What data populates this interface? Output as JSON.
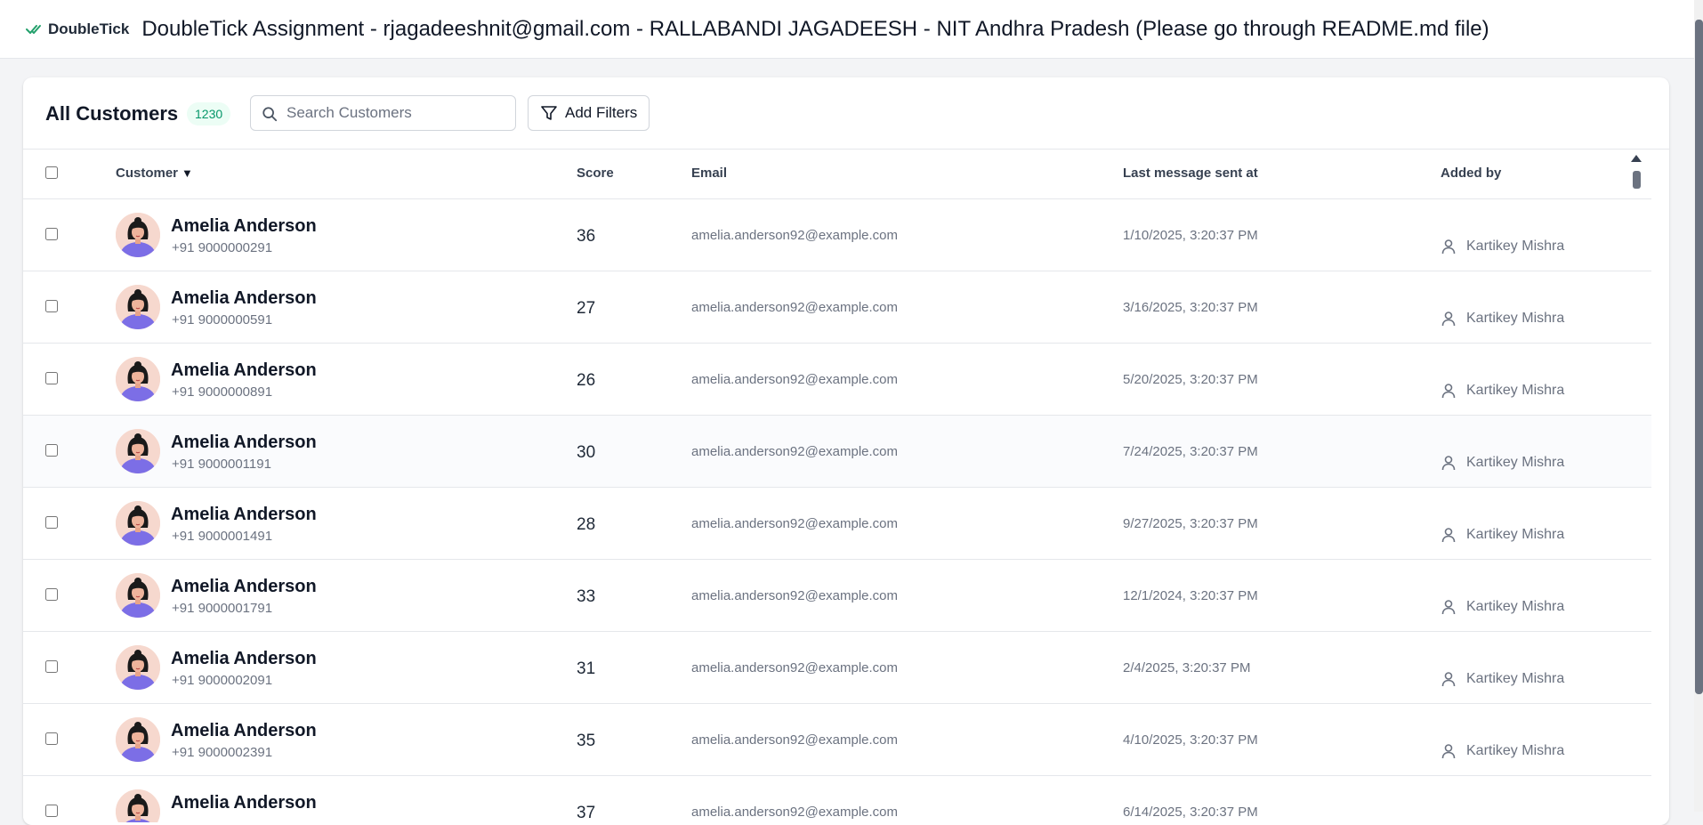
{
  "header": {
    "brand": "DoubleTick",
    "title": "DoubleTick Assignment - rjagadeeshnit@gmail.com - RALLABANDI JAGADEESH - NIT Andhra Pradesh (Please go through README.md file)"
  },
  "toolbar": {
    "title": "All Customers",
    "count": "1230",
    "search_placeholder": "Search Customers",
    "search_value": "",
    "filter_label": "Add Filters"
  },
  "columns": {
    "customer": "Customer",
    "score": "Score",
    "email": "Email",
    "last_message": "Last message sent at",
    "added_by": "Added by"
  },
  "rows": [
    {
      "name": "Amelia Anderson",
      "phone": "+91 9000000291",
      "score": "36",
      "email": "amelia.anderson92@example.com",
      "last_message": "1/10/2025, 3:20:37 PM",
      "added_by": "Kartikey Mishra"
    },
    {
      "name": "Amelia Anderson",
      "phone": "+91 9000000591",
      "score": "27",
      "email": "amelia.anderson92@example.com",
      "last_message": "3/16/2025, 3:20:37 PM",
      "added_by": "Kartikey Mishra"
    },
    {
      "name": "Amelia Anderson",
      "phone": "+91 9000000891",
      "score": "26",
      "email": "amelia.anderson92@example.com",
      "last_message": "5/20/2025, 3:20:37 PM",
      "added_by": "Kartikey Mishra"
    },
    {
      "name": "Amelia Anderson",
      "phone": "+91 9000001191",
      "score": "30",
      "email": "amelia.anderson92@example.com",
      "last_message": "7/24/2025, 3:20:37 PM",
      "added_by": "Kartikey Mishra"
    },
    {
      "name": "Amelia Anderson",
      "phone": "+91 9000001491",
      "score": "28",
      "email": "amelia.anderson92@example.com",
      "last_message": "9/27/2025, 3:20:37 PM",
      "added_by": "Kartikey Mishra"
    },
    {
      "name": "Amelia Anderson",
      "phone": "+91 9000001791",
      "score": "33",
      "email": "amelia.anderson92@example.com",
      "last_message": "12/1/2024, 3:20:37 PM",
      "added_by": "Kartikey Mishra"
    },
    {
      "name": "Amelia Anderson",
      "phone": "+91 9000002091",
      "score": "31",
      "email": "amelia.anderson92@example.com",
      "last_message": "2/4/2025, 3:20:37 PM",
      "added_by": "Kartikey Mishra"
    },
    {
      "name": "Amelia Anderson",
      "phone": "+91 9000002391",
      "score": "35",
      "email": "amelia.anderson92@example.com",
      "last_message": "4/10/2025, 3:20:37 PM",
      "added_by": "Kartikey Mishra"
    },
    {
      "name": "Amelia Anderson",
      "phone": "",
      "score": "37",
      "email": "amelia.anderson92@example.com",
      "last_message": "6/14/2025, 3:20:37 PM",
      "added_by": ""
    }
  ],
  "icons": {
    "brand": "double-check-icon",
    "search": "search-icon",
    "filter": "filter-icon",
    "sort": "sort-down-icon",
    "user": "user-icon",
    "avatar": "avatar-illustration"
  },
  "colors": {
    "brand_green": "#22a06b",
    "badge_bg": "#ecfdf5",
    "badge_text": "#059669",
    "avatar_shirt": "#7c6ee6"
  }
}
